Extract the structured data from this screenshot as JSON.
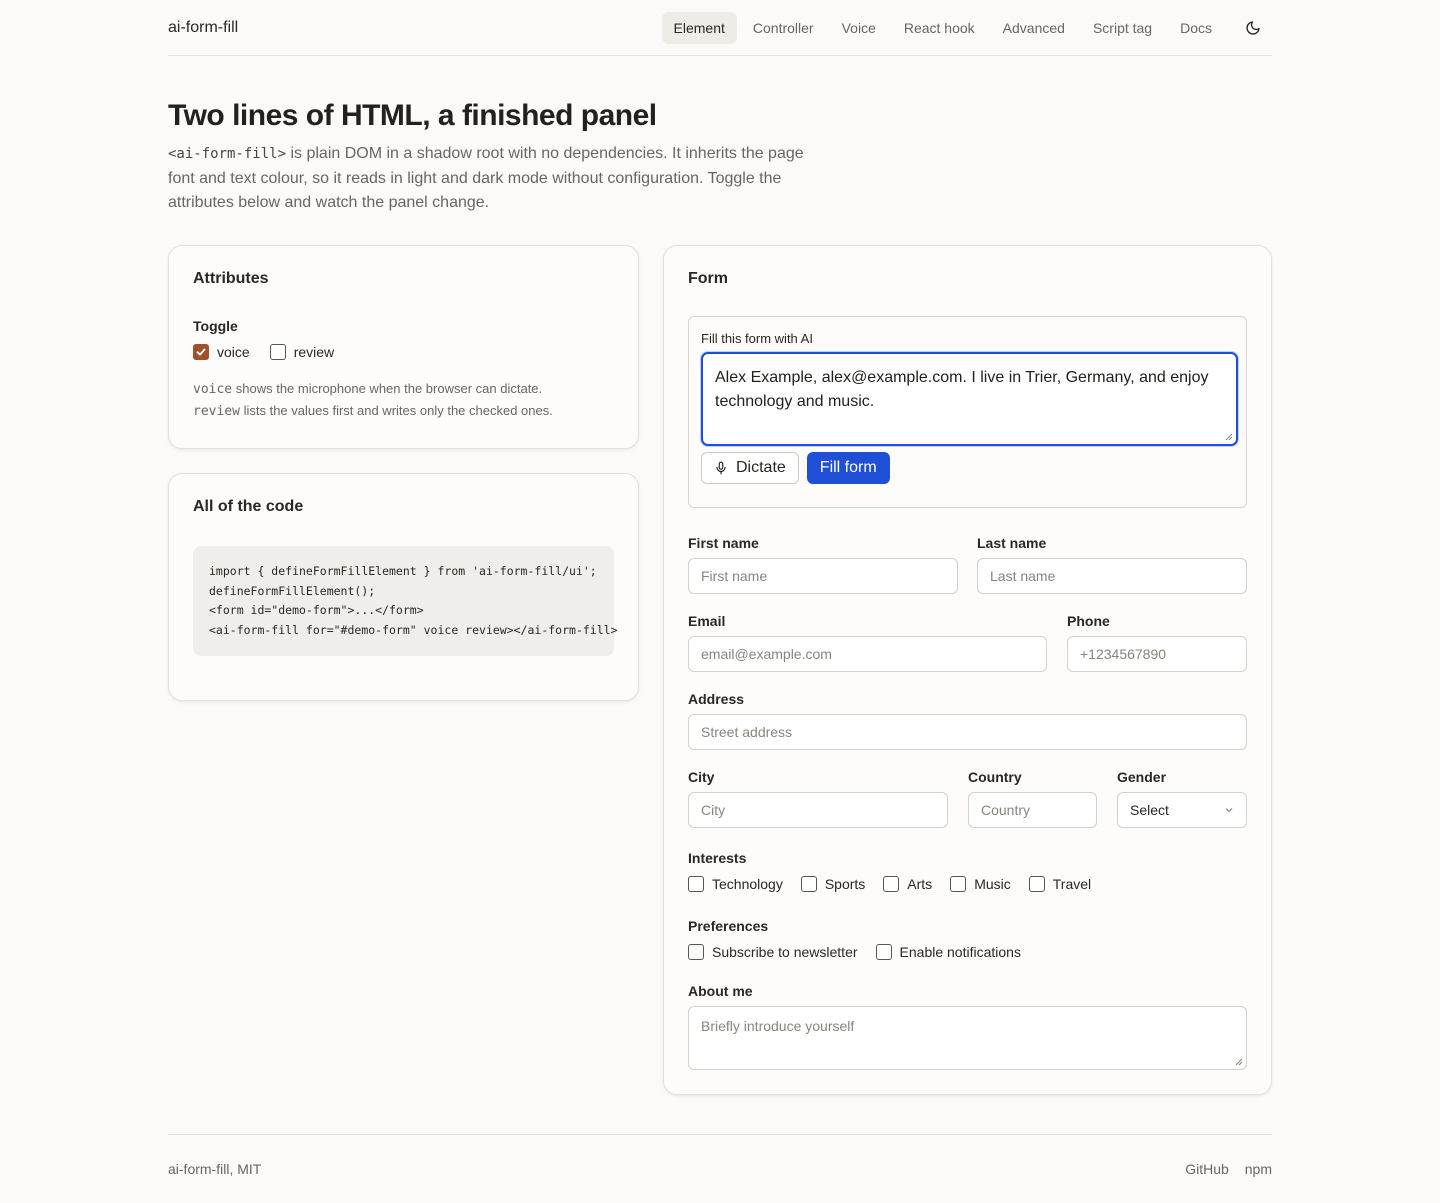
{
  "header": {
    "brand": "ai-form-fill",
    "nav": [
      "Element",
      "Controller",
      "Voice",
      "React hook",
      "Advanced",
      "Script tag",
      "Docs"
    ],
    "active_nav": "Element",
    "theme_icon": "moon-icon"
  },
  "hero": {
    "title": "Two lines of HTML, a finished panel",
    "lead_code": "<ai-form-fill>",
    "lead_text": " is plain DOM in a shadow root with no dependencies. It inherits the page font and text colour, so it reads in light and dark mode without configuration. Toggle the attributes below and watch the panel change."
  },
  "attributes": {
    "title": "Attributes",
    "toggle_label": "Toggle",
    "voice_label": "voice",
    "voice_checked": true,
    "review_label": "review",
    "review_checked": false,
    "note1_code": "voice",
    "note1_text": " shows the microphone when the browser can dictate.",
    "note2_code": "review",
    "note2_text": " lists the values first and writes only the checked ones."
  },
  "code": {
    "title": "All of the code",
    "line1": "import { defineFormFillElement } from 'ai-form-fill/ui';",
    "line2": "defineFormFillElement();",
    "line3": "",
    "line4": "<form id=\"demo-form\">...</form>",
    "line5": "<ai-form-fill for=\"#demo-form\" voice review></ai-form-fill>"
  },
  "form": {
    "title": "Form",
    "ai_label": "Fill this form with AI",
    "ai_value": "Alex Example, alex@example.com. I live in Trier, Germany, and enjoy technology and music.",
    "dictate_label": "Dictate",
    "fill_label": "Fill form",
    "first_name": {
      "label": "First name",
      "placeholder": "First name"
    },
    "last_name": {
      "label": "Last name",
      "placeholder": "Last name"
    },
    "email": {
      "label": "Email",
      "placeholder": "email@example.com"
    },
    "phone": {
      "label": "Phone",
      "placeholder": "+1234567890"
    },
    "address": {
      "label": "Address",
      "placeholder": "Street address"
    },
    "city": {
      "label": "City",
      "placeholder": "City"
    },
    "country": {
      "label": "Country",
      "placeholder": "Country"
    },
    "gender": {
      "label": "Gender",
      "value": "Select"
    },
    "interests_label": "Interests",
    "interests": [
      "Technology",
      "Sports",
      "Arts",
      "Music",
      "Travel"
    ],
    "preferences_label": "Preferences",
    "preferences": [
      "Subscribe to newsletter",
      "Enable notifications"
    ],
    "about": {
      "label": "About me",
      "placeholder": "Briefly introduce yourself"
    }
  },
  "footer": {
    "left": "ai-form-fill, MIT",
    "links": [
      "GitHub",
      "npm"
    ]
  }
}
